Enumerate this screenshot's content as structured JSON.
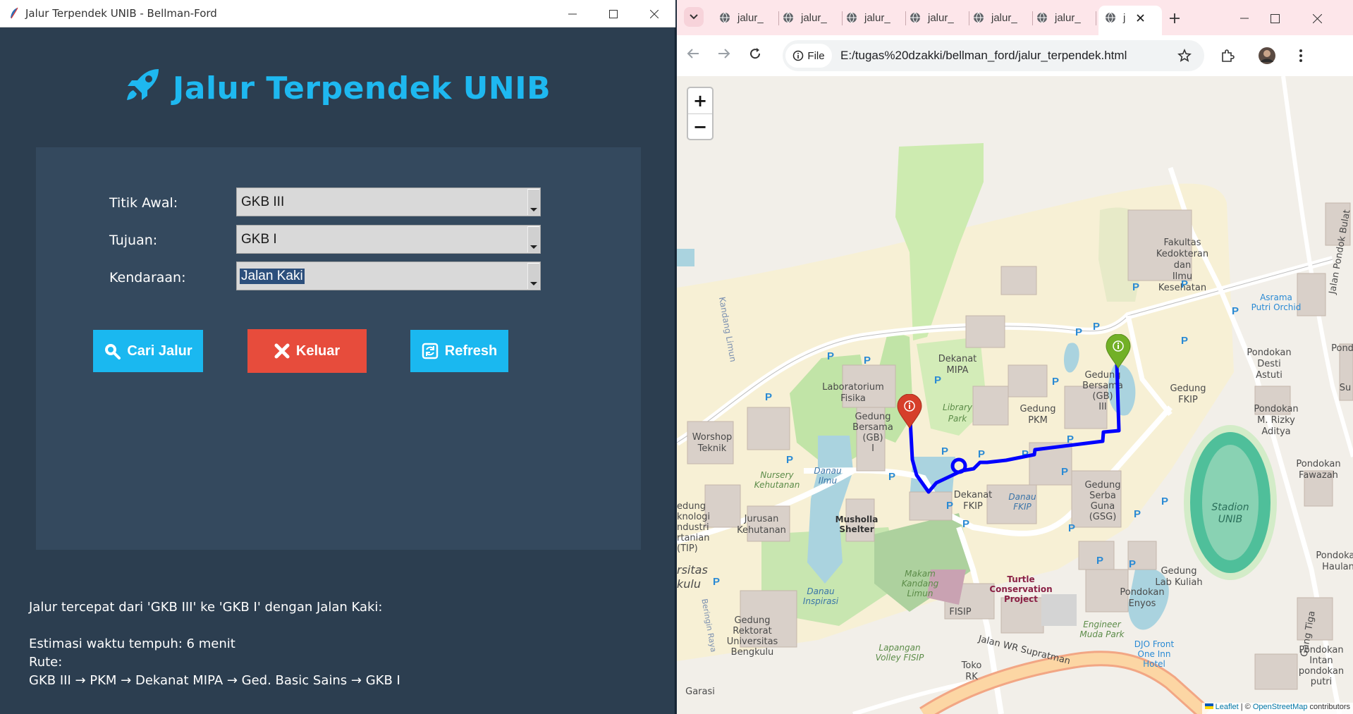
{
  "tk": {
    "window_title": "Jalur Terpendek UNIB - Bellman-Ford",
    "heading": "Jalur Terpendek UNIB",
    "form": {
      "start_label": "Titik Awal:",
      "start_value": "GKB III",
      "dest_label": "Tujuan:",
      "dest_value": "GKB I",
      "vehicle_label": "Kendaraan:",
      "vehicle_value": "Jalan Kaki"
    },
    "buttons": {
      "search": "Cari Jalur",
      "exit": "Keluar",
      "refresh": "Refresh"
    },
    "result": {
      "line1": "Jalur tercepat dari 'GKB III' ke 'GKB I' dengan Jalan Kaki:",
      "line2": "Estimasi waktu tempuh: 6 menit",
      "line3": "Rute:",
      "line4": "GKB III → PKM → Dekanat MIPA → Ged. Basic Sains → GKB I"
    },
    "colors": {
      "bg": "#2c3e50",
      "panel": "#34495e",
      "accent": "#1eb8f0",
      "search_btn": "#1ab8f0",
      "exit_btn": "#e74c3c",
      "refresh_btn": "#1ab8f0"
    }
  },
  "browser": {
    "tabs": [
      "jalur_",
      "jalur_",
      "jalur_",
      "jalur_",
      "jalur_",
      "jalur_",
      "j"
    ],
    "file_chip": "File",
    "url": "E:/tugas%20dzakki/bellman_ford/jalur_terpendek.html",
    "zoom_in": "+",
    "zoom_out": "−",
    "attribution_leaflet": "Leaflet",
    "attribution_sep": " | © ",
    "attribution_osm": "OpenStreetMap",
    "attribution_tail": " contributors",
    "map_labels": {
      "fk": [
        "Fakultas",
        "Kedokteran",
        "dan",
        "Ilmu",
        "Kesehatan"
      ],
      "asrama": [
        "Asrama",
        "Putri Orchid"
      ],
      "jalan_pondok_bulat": "Jalan Pondok Bulat",
      "kandang_limun": "Kandang Limun",
      "dekanat_mipa": [
        "Dekanat",
        "MIPA"
      ],
      "lab_fisika": [
        "Laboratorium",
        "Fisika"
      ],
      "gb1": [
        "Gedung",
        "Bersama",
        "(GB)",
        "I"
      ],
      "library_park": [
        "Library",
        "Park"
      ],
      "gedung_pkm": [
        "Gedung",
        "PKM"
      ],
      "gb3": [
        "Gedung",
        "Bersama",
        "(GB)",
        "III"
      ],
      "gedung_fkip": [
        "Gedung",
        "FKIP"
      ],
      "pondokan_desti": [
        "Pondokan",
        "Desti",
        "Astuti"
      ],
      "pondokan_rizky": [
        "Pondokan",
        "M. Rizky",
        "Aditya"
      ],
      "pondokan_su": [
        "Pondo",
        "Su"
      ],
      "pondokan_fawazah": [
        "Pondokan",
        "Fawazah"
      ],
      "workshop": [
        "Worshop",
        "Teknik"
      ],
      "nursery": [
        "Nursery",
        "Kehutanan"
      ],
      "danau_ilmu": [
        "Danau",
        "Ilmu"
      ],
      "dekanat_fkip": [
        "Dekanat",
        "FKIP"
      ],
      "danau_fkip": [
        "Danau",
        "FKIP"
      ],
      "gsg": [
        "Gedung",
        "Serba",
        "Guna",
        "(GSG)"
      ],
      "stadion": [
        "Stadion",
        "UNIB"
      ],
      "tip": [
        "edung",
        "knologi",
        "ndustri",
        "rtanian",
        "(TIP)"
      ],
      "jurusan_kehutanan": [
        "Jurusan",
        "Kehutanan"
      ],
      "musholla": [
        "Musholla",
        "Shelter"
      ],
      "pondokan_haulan": [
        "Pondokan",
        "Haulan"
      ],
      "sitas": [
        "rsitas",
        "kulu"
      ],
      "makam": [
        "Makam",
        "Kandang",
        "Limun"
      ],
      "turtle": [
        "Turtle",
        "Conservation",
        "Project"
      ],
      "gedung_kuliah": [
        "Gedung",
        "Lab Kuliah"
      ],
      "pondokan_enyos": [
        "Pondokan",
        "Enyos"
      ],
      "danau_inspirasi": [
        "Danau",
        "Inspirasi"
      ],
      "fisip": "FISIP",
      "engineer_park": [
        "Engineer",
        "Muda Park"
      ],
      "djo": [
        "DJO Front",
        "One Inn",
        "Hotel"
      ],
      "gang_tiga": "Gang Tiga",
      "rektorat": [
        "Gedung",
        "Rektorat",
        "Universitas",
        "Bengkulu"
      ],
      "lapangan": [
        "Lapangan",
        "Volley FISIP"
      ],
      "jalan_wr": "Jalan WR Supratman",
      "toko_rk": [
        "Toko",
        "RK"
      ],
      "pondokan_intan": [
        "Pondokan",
        "Intan",
        "pondokan",
        "putri"
      ],
      "garasi": "Garasi",
      "beringin_raya": "Beringin Raya"
    },
    "route_color": "#0000ff",
    "start_marker_color": "#72b026",
    "end_marker_color": "#d63e2a"
  }
}
